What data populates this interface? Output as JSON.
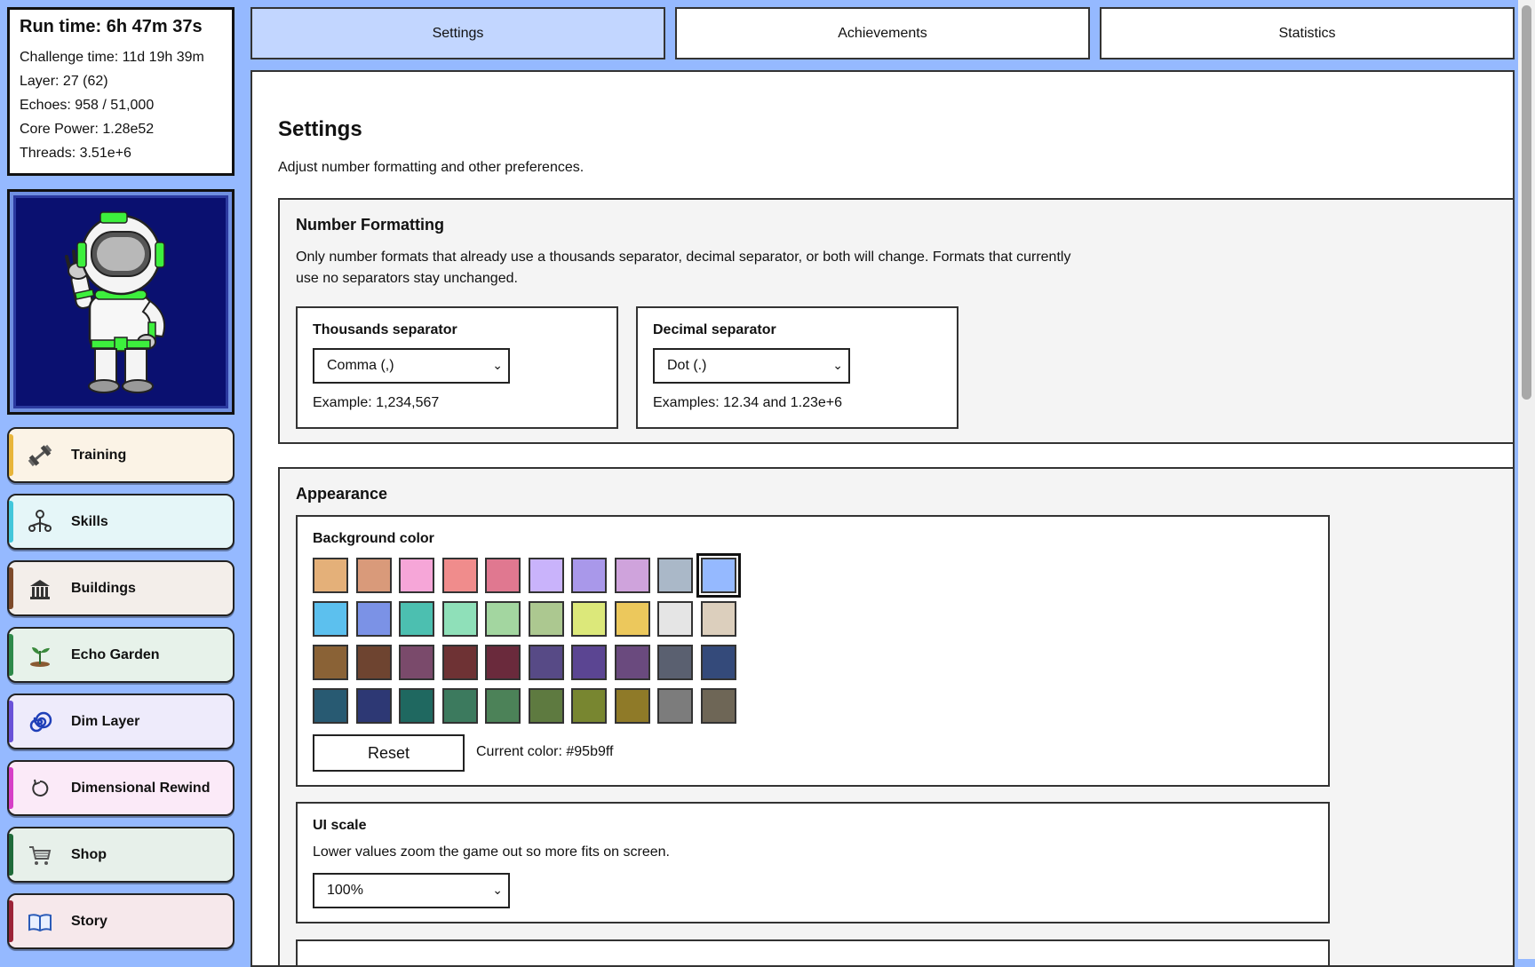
{
  "stats": {
    "run_time": "Run time: 6h 47m 37s",
    "challenge_time": "Challenge time: 11d 19h 39m",
    "layer": "Layer: 27 (62)",
    "echoes": "Echoes: 958 / 51,000",
    "core_power": "Core Power: 1.28e52",
    "threads": "Threads: 3.51e+6"
  },
  "nav": [
    {
      "label": "Training",
      "icon": "dumbbell-icon",
      "bg": "#fbf3e6",
      "accent": "#e8b53a"
    },
    {
      "label": "Skills",
      "icon": "skill-tree-icon",
      "bg": "#e5f6f8",
      "accent": "#43c7db"
    },
    {
      "label": "Buildings",
      "icon": "building-icon",
      "bg": "#f3eeea",
      "accent": "#7d4a2a"
    },
    {
      "label": "Echo Garden",
      "icon": "plant-icon",
      "bg": "#e7f2ea",
      "accent": "#2e8a4a"
    },
    {
      "label": "Dim Layer",
      "icon": "spiral-icon",
      "bg": "#eeebfb",
      "accent": "#6a52d8"
    },
    {
      "label": "Dimensional Rewind",
      "icon": "rewind-icon",
      "bg": "#fbeaf8",
      "accent": "#d63fc7"
    },
    {
      "label": "Shop",
      "icon": "cart-icon",
      "bg": "#e7f0ea",
      "accent": "#1f6b3a"
    },
    {
      "label": "Story",
      "icon": "book-icon",
      "bg": "#f6e8eb",
      "accent": "#9c2438"
    }
  ],
  "tabs": [
    {
      "label": "Settings",
      "active": true
    },
    {
      "label": "Achievements",
      "active": false
    },
    {
      "label": "Statistics",
      "active": false
    }
  ],
  "page": {
    "title": "Settings",
    "description": "Adjust number formatting and other preferences."
  },
  "number_formatting": {
    "title": "Number Formatting",
    "description": "Only number formats that already use a thousands separator, decimal separator, or both will change. Formats that currently use no separators stay unchanged.",
    "thousands": {
      "label": "Thousands separator",
      "value": "Comma (,)",
      "example": "Example: 1,234,567"
    },
    "decimal": {
      "label": "Decimal separator",
      "value": "Dot (.)",
      "example": "Examples: 12.34 and 1.23e+6"
    }
  },
  "appearance": {
    "title": "Appearance",
    "background_color": {
      "label": "Background color",
      "swatches": [
        "#e4b079",
        "#d99a7a",
        "#f6a6d8",
        "#f08c8c",
        "#e07890",
        "#c9b3fb",
        "#a998ea",
        "#cfa3dc",
        "#aab8c8",
        "#95b9ff",
        "#5cc0ee",
        "#7b92e6",
        "#4cbfb0",
        "#8fe0b9",
        "#a3d6a0",
        "#acc890",
        "#dce87a",
        "#ecc85c",
        "#e5e5e5",
        "#dccfbd",
        "#8a6236",
        "#6e4430",
        "#7a4a6b",
        "#6e3234",
        "#6a2a3c",
        "#574a86",
        "#5b4592",
        "#6a4a7e",
        "#5a6070",
        "#344a7a",
        "#285a72",
        "#2d3874",
        "#1f6860",
        "#3c7a5e",
        "#4c8258",
        "#5e7a40",
        "#788630",
        "#8f7a28",
        "#7c7c7c",
        "#6e6656"
      ],
      "selected_index": 9,
      "reset_label": "Reset",
      "current_color_text": "Current color: #95b9ff"
    },
    "ui_scale": {
      "label": "UI scale",
      "description": "Lower values zoom the game out so more fits on screen.",
      "value": "100%"
    }
  }
}
